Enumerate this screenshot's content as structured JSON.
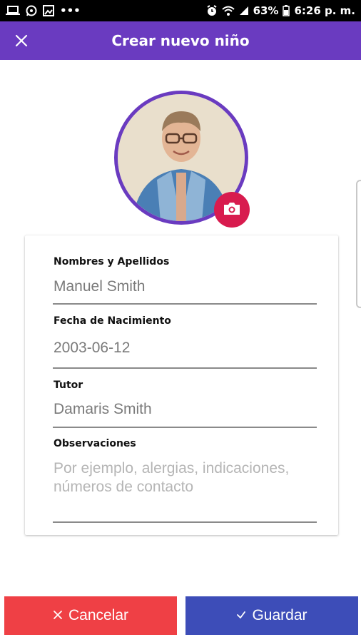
{
  "status_bar": {
    "battery": "63%",
    "time": "6:26 p. m.",
    "dots": "•••"
  },
  "app_bar": {
    "title": "Crear nuevo niño"
  },
  "form": {
    "name": {
      "label": "Nombres y Apellidos",
      "value": "Manuel Smith"
    },
    "birthdate": {
      "label": "Fecha de Nacimiento",
      "value": "2003-06-12"
    },
    "tutor": {
      "label": "Tutor",
      "value": "Damaris Smith"
    },
    "observations": {
      "label": "Observaciones",
      "placeholder": "Por ejemplo, alergias, indicaciones, números de contacto"
    }
  },
  "buttons": {
    "cancel": "Cancelar",
    "save": "Guardar"
  },
  "colors": {
    "primary": "#6a3bc0",
    "camera": "#d81b4e",
    "cancel": "#ef4045",
    "save": "#3d4db8"
  },
  "icons": [
    "laptop-icon",
    "whatsapp-icon",
    "gallery-icon",
    "alarm-icon",
    "wifi-icon",
    "signal-icon",
    "battery-icon",
    "close-icon",
    "camera-icon",
    "x-icon",
    "checkmark-icon"
  ]
}
